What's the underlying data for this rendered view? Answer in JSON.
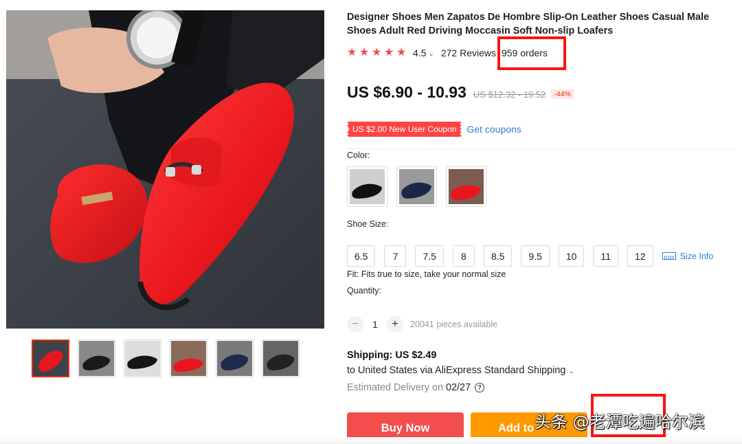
{
  "product": {
    "title": "Designer Shoes Men Zapatos De Hombre Slip-On Leather Shoes Casual Male Shoes Adult Red Driving Moccasin Soft Non-slip Loafers",
    "rating": "4.5",
    "reviews": "272 Reviews",
    "orders": "959 orders",
    "price": "US $6.90 - 10.93",
    "old_price": "US $12.32 - 19.52",
    "discount": "-44%"
  },
  "coupon": {
    "tag": "US $2.00 New User Coupon",
    "link": "Get coupons"
  },
  "options": {
    "color_label": "Color:",
    "color_swatches": [
      "red-suede",
      "navy-suede",
      "black-suede"
    ],
    "size_label": "Shoe Size:",
    "sizes": [
      "6.5",
      "7",
      "7.5",
      "8",
      "8.5",
      "9.5",
      "10",
      "11",
      "12"
    ],
    "size_info": "Size Info",
    "fit_note": "Fit: Fits true to size, take your normal size"
  },
  "quantity": {
    "label": "Quantity:",
    "value": "1",
    "available": "20041 pieces available",
    "minus": "−",
    "plus": "+"
  },
  "shipping": {
    "title": "Shipping: US $2.49",
    "destination": "to United States via AliExpress Standard Shipping",
    "estimated_label": "Estimated Delivery on",
    "estimated_date": "02/27",
    "help": "?"
  },
  "actions": {
    "buy_now": "Buy Now",
    "add_to_cart": "Add to"
  },
  "watermark": "头条 @老潭吃遍哈尔滨",
  "colors": {
    "accent_red": "#f24e4e",
    "cart_orange": "#ff9900",
    "link_blue": "#2e7bd6",
    "annotation_red": "#ff1111"
  },
  "icons": [
    "star-icon",
    "chevron-down-icon",
    "ruler-icon",
    "help-circle-icon",
    "minus-icon",
    "plus-icon"
  ]
}
